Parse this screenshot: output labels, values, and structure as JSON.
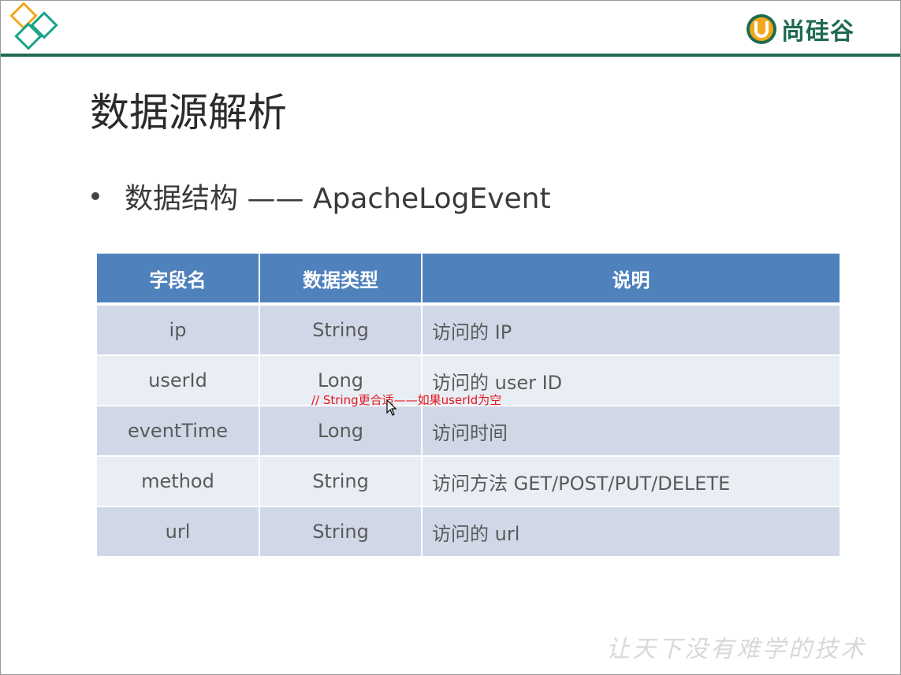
{
  "brand": {
    "name": "尚硅谷",
    "logo_icon": "u-logo-icon",
    "color": "#1f6b4f"
  },
  "decor": {
    "corner_logo": "diamond-logo-icon",
    "corner_colors": [
      "#f2a81d",
      "#1aa389"
    ]
  },
  "slide": {
    "title": "数据源解析",
    "bullet": "数据结构 —— ApacheLogEvent"
  },
  "table": {
    "header_color": "#4f81bd",
    "headers": [
      "字段名",
      "数据类型",
      "说明"
    ],
    "rows": [
      [
        "ip",
        "String",
        "访问的 IP"
      ],
      [
        "userId",
        "Long",
        "访问的 user ID"
      ],
      [
        "eventTime",
        "Long",
        "访问时间"
      ],
      [
        "method",
        "String",
        "访问方法 GET/POST/PUT/DELETE"
      ],
      [
        "url",
        "String",
        "访问的 url"
      ]
    ]
  },
  "annotation": {
    "text": "// String更合适——如果userId为空",
    "color": "#e3171f"
  },
  "watermark": "让天下没有难学的技术"
}
